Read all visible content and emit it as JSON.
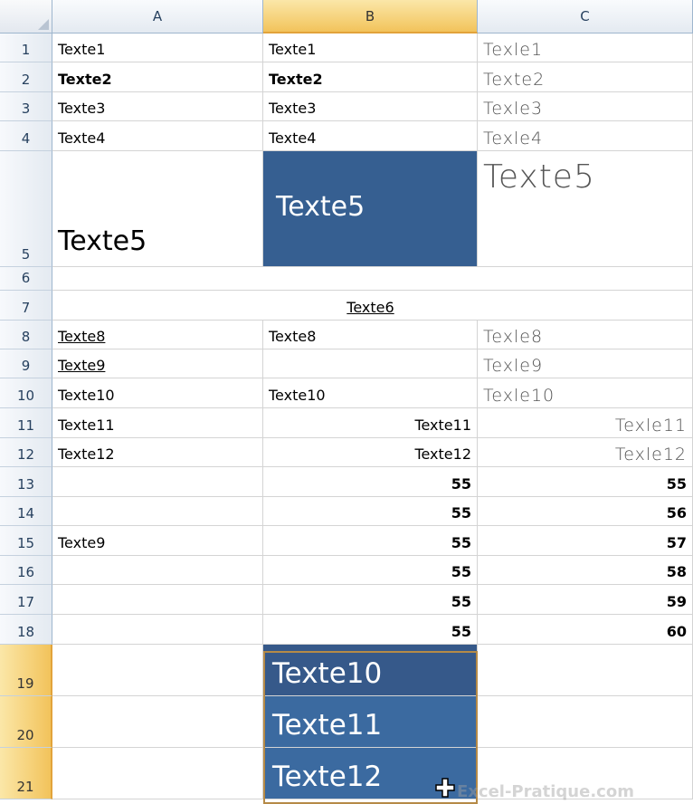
{
  "columns": [
    "A",
    "B",
    "C"
  ],
  "rows": [
    {
      "num": "1",
      "a": "Texte1",
      "b": "Texte1",
      "c": "Texle1"
    },
    {
      "num": "2",
      "a": "Texte2",
      "b": "Texte2",
      "c": "Texte2"
    },
    {
      "num": "3",
      "a": "Texte3",
      "b": "Texte3",
      "c": "Texle3"
    },
    {
      "num": "4",
      "a": "Texte4",
      "b": "Texte4",
      "c": "Texle4"
    },
    {
      "num": "5",
      "a": "Texte5",
      "b": "Texte5",
      "c": "Texte5"
    },
    {
      "num": "6",
      "a": "",
      "b": "",
      "c": ""
    },
    {
      "num": "7",
      "a": "",
      "b": "Texte6",
      "c": ""
    },
    {
      "num": "8",
      "a": "Texte8",
      "b": "Texte8",
      "c": "Texle8"
    },
    {
      "num": "9",
      "a": "Texte9",
      "b": "",
      "c": "Texle9"
    },
    {
      "num": "10",
      "a": "Texte10",
      "b": "Texte10",
      "c": "Texle10"
    },
    {
      "num": "11",
      "a": "Texte11",
      "b": "Texte11",
      "c": "Texle11"
    },
    {
      "num": "12",
      "a": "Texte12",
      "b": "Texte12",
      "c": "Texle12"
    },
    {
      "num": "13",
      "a": "",
      "b": "55",
      "c": "55"
    },
    {
      "num": "14",
      "a": "",
      "b": "55",
      "c": "56"
    },
    {
      "num": "15",
      "a": "Texte9",
      "b": "55",
      "c": "57"
    },
    {
      "num": "16",
      "a": "",
      "b": "55",
      "c": "58"
    },
    {
      "num": "17",
      "a": "",
      "b": "55",
      "c": "59"
    },
    {
      "num": "18",
      "a": "",
      "b": "55",
      "c": "60"
    },
    {
      "num": "19",
      "a": "",
      "b": "Texte10",
      "c": ""
    },
    {
      "num": "20",
      "a": "",
      "b": "Texte11",
      "c": ""
    },
    {
      "num": "21",
      "a": "",
      "b": "Texte12",
      "c": ""
    }
  ],
  "selected_column": "B",
  "selected_rows": [
    "19",
    "20",
    "21"
  ],
  "watermark": "Excel-Pratique.com",
  "colors": {
    "highlight_blue": "#365f91",
    "selection_blue": "#3b6aa0",
    "header_selected": "#f2c35b"
  },
  "icons": {
    "cursor": "fill-cross-cursor-icon"
  }
}
